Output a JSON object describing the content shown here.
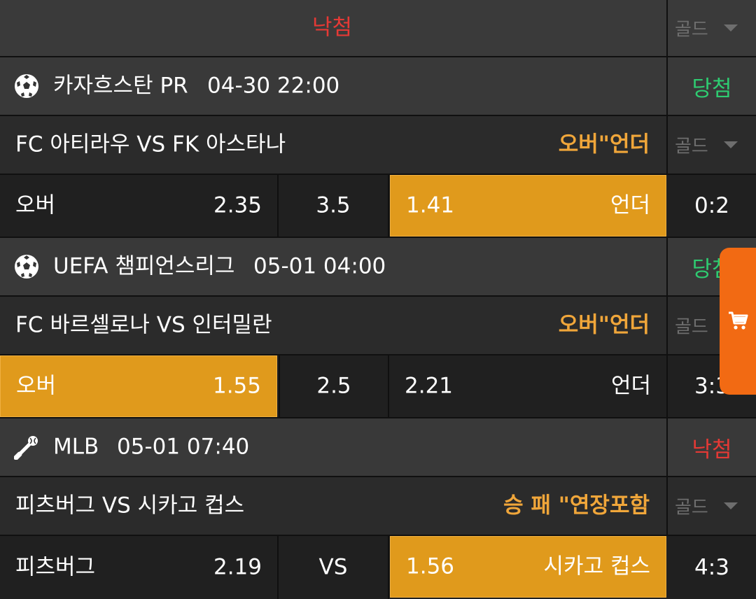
{
  "header": {
    "result": "낙첨",
    "gold": "골드"
  },
  "matches": [
    {
      "league": "카자흐스탄 PR",
      "datetime": "04-30 22:00",
      "result": "당첨",
      "teams": "FC 아티라우 VS FK 아스타나",
      "bet_type": "오버\"언더",
      "gold": "골드",
      "left_label": "오버",
      "left_odds": "2.35",
      "center": "3.5",
      "right_odds": "1.41",
      "right_label": "언더",
      "score": "0:2",
      "icon": "soccer-ball-icon"
    },
    {
      "league": "UEFA 챔피언스리그",
      "datetime": "05-01 04:00",
      "result": "당첨",
      "teams": "FC 바르셀로나 VS 인터밀란",
      "bet_type": "오버\"언더",
      "gold": "골드",
      "left_label": "오버",
      "left_odds": "1.55",
      "center": "2.5",
      "right_odds": "2.21",
      "right_label": "언더",
      "score": "3:3",
      "icon": "soccer-ball-icon"
    },
    {
      "league": "MLB",
      "datetime": "05-01 07:40",
      "result": "낙첨",
      "teams": "피츠버그 VS 시카고 컵스",
      "bet_type": "승 패 \"연장포함",
      "gold": "골드",
      "left_label": "피츠버그",
      "left_odds": "2.19",
      "center": "VS",
      "right_odds": "1.56",
      "right_label": "시카고 컵스",
      "score": "4:3",
      "icon": "baseball-icon"
    }
  ],
  "cart": {
    "icon": "shopping-cart-icon"
  },
  "colors": {
    "win": "#2ecc71",
    "lose": "#e53935",
    "selected": "#e09a1c",
    "bet_type": "#f0a63a",
    "cart_tab": "#f26a13"
  }
}
